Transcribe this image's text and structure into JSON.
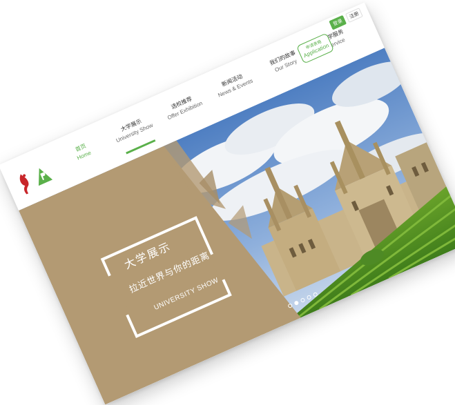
{
  "brand": {
    "accent": "#5ab04a",
    "panel": "#b39a73"
  },
  "nav": {
    "items": [
      {
        "cn": "首页",
        "en": "Home"
      },
      {
        "cn": "大学展示",
        "en": "University Show"
      },
      {
        "cn": "选校推荐",
        "en": "Offer Exhibition"
      },
      {
        "cn": "新闻活动",
        "en": "News & Events"
      },
      {
        "cn": "我们的故事",
        "en": "Our Story"
      },
      {
        "cn": "留学服务",
        "en": "Service"
      }
    ]
  },
  "apply": {
    "cn": "申请表格",
    "en": "Application"
  },
  "auth": {
    "login": "登录",
    "register": "注册"
  },
  "hero": {
    "title": "大学展示",
    "subtitle": "拉近世界与你的距离",
    "en": "UNIVERSITY SHOW"
  },
  "carousel": {
    "count": 5,
    "active_index": 1
  },
  "icons": [
    "logo-mark-icon",
    "logo-triangle-icon"
  ]
}
